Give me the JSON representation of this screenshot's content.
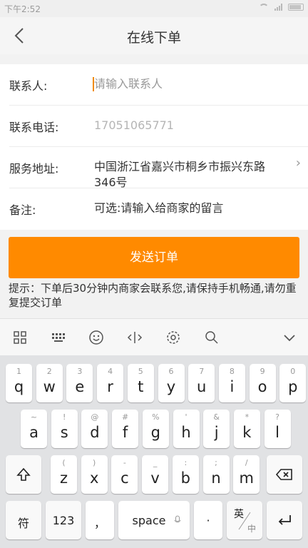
{
  "status_bar": {
    "time": "下午2:52"
  },
  "nav": {
    "title": "在线下单"
  },
  "form": {
    "contact_label": "联系人:",
    "contact_placeholder": "请输入联系人",
    "phone_label": "联系电话:",
    "phone_placeholder": "17051065771",
    "address_label": "服务地址:",
    "address_value": "中国浙江省嘉兴市桐乡市振兴东路346号",
    "note_label": "备注:",
    "note_placeholder": "可选:请输入给商家的留言"
  },
  "submit_label": "发送订单",
  "tip": "提示：下单后30分钟内商家会联系您,请保持手机畅通,请勿重复提交订单",
  "keyboard": {
    "row1": [
      {
        "k": "q",
        "s": "1"
      },
      {
        "k": "w",
        "s": "2"
      },
      {
        "k": "e",
        "s": "3"
      },
      {
        "k": "r",
        "s": "4"
      },
      {
        "k": "t",
        "s": "5"
      },
      {
        "k": "y",
        "s": "6"
      },
      {
        "k": "u",
        "s": "7"
      },
      {
        "k": "i",
        "s": "8"
      },
      {
        "k": "o",
        "s": "9"
      },
      {
        "k": "p",
        "s": "0"
      }
    ],
    "row2": [
      {
        "k": "a",
        "s": "~"
      },
      {
        "k": "s",
        "s": "!"
      },
      {
        "k": "d",
        "s": "@"
      },
      {
        "k": "f",
        "s": "#"
      },
      {
        "k": "g",
        "s": "%"
      },
      {
        "k": "h",
        "s": "'"
      },
      {
        "k": "j",
        "s": "&"
      },
      {
        "k": "k",
        "s": "*"
      },
      {
        "k": "l",
        "s": "?"
      }
    ],
    "row3": [
      {
        "k": "z",
        "s": "("
      },
      {
        "k": "x",
        "s": ")"
      },
      {
        "k": "c",
        "s": "-"
      },
      {
        "k": "v",
        "s": "_"
      },
      {
        "k": "b",
        "s": ":"
      },
      {
        "k": "n",
        "s": ";"
      },
      {
        "k": "m",
        "s": "/"
      }
    ],
    "symbol_key": "符",
    "num_key": "123",
    "comma_key": "，",
    "space_key": "space",
    "period_key": "·",
    "lang_key_top": "英",
    "lang_key_bottom": "中"
  }
}
